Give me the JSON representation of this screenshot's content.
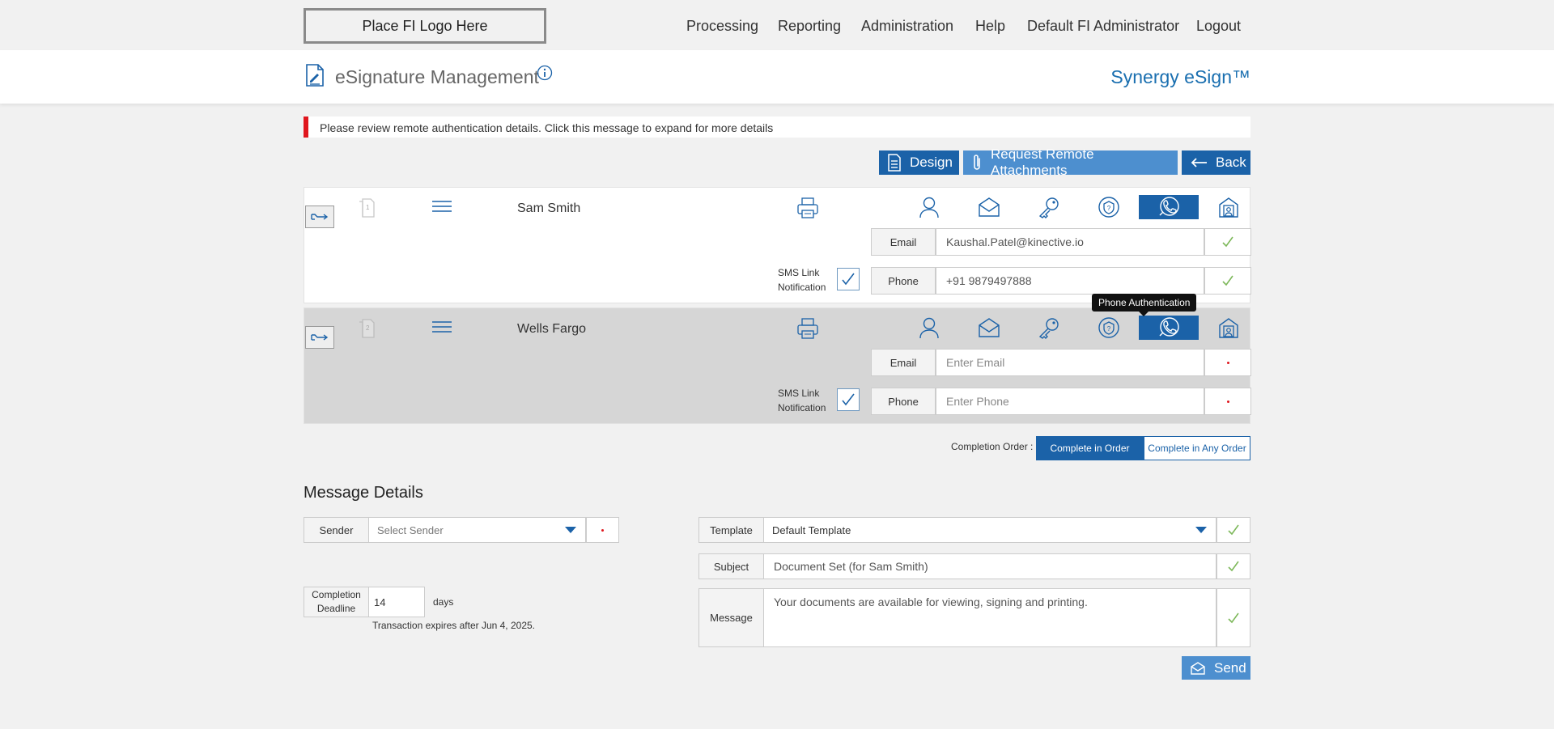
{
  "header": {
    "logo_text": "Place FI Logo Here",
    "nav": [
      "Processing",
      "Reporting",
      "Administration",
      "Help",
      "Default FI Administrator",
      "Logout"
    ],
    "page_title": "eSignature Management",
    "brand": "Synergy eSign™"
  },
  "alert": {
    "text": "Please review remote authentication details. Click this message to expand for more details",
    "color": "#e0161d"
  },
  "actions": {
    "design": "Design",
    "request_attachments": "Request Remote Attachments",
    "back": "Back"
  },
  "signers": [
    {
      "order": "1",
      "name": "Sam Smith",
      "email_label": "Email",
      "email_value": "Kaushal.Patel@kinective.io",
      "email_placeholder": "Enter Email",
      "phone_label": "Phone",
      "phone_value": "+91 9879497888",
      "phone_placeholder": "Enter Phone",
      "sms_label_1": "SMS Link",
      "sms_label_2": "Notification",
      "sms_checked": true,
      "active_auth": "phone-authentication"
    },
    {
      "order": "2",
      "name": "Wells Fargo",
      "email_label": "Email",
      "email_value": "",
      "email_placeholder": "Enter Email",
      "phone_label": "Phone",
      "phone_value": "",
      "phone_placeholder": "Enter Phone",
      "sms_label_1": "SMS Link",
      "sms_label_2": "Notification",
      "sms_checked": true,
      "active_auth": "phone-authentication"
    }
  ],
  "tooltip": "Phone Authentication",
  "completion_order": {
    "label": "Completion Order :",
    "in_order": "Complete in Order",
    "any_order": "Complete in Any Order",
    "selected": "in_order"
  },
  "message_details": {
    "title": "Message Details",
    "sender_label": "Sender",
    "sender_value": "Select Sender",
    "deadline_label_1": "Completion",
    "deadline_label_2": "Deadline",
    "deadline_value": "14",
    "deadline_unit": "days",
    "expires_text": "Transaction expires after Jun 4, 2025.",
    "template_label": "Template",
    "template_value": "Default Template",
    "subject_label": "Subject",
    "subject_value": "Document Set (for Sam Smith)",
    "message_label": "Message",
    "message_value": "Your documents are available for viewing, signing and printing.",
    "send": "Send"
  },
  "colors": {
    "primary": "#1b62a8",
    "primary_light": "#4d8fcf",
    "brand": "#1a6fb0",
    "check_green": "#7db85a",
    "required_red": "#e0161d"
  },
  "icons": {
    "page_title": "document-signature-icon",
    "info": "info-icon",
    "design": "document-list-icon",
    "attachments": "paperclip-icon",
    "back": "arrow-left-icon",
    "send": "envelope-icon"
  }
}
